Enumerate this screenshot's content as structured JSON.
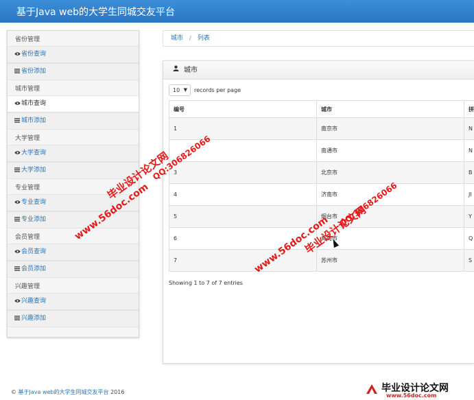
{
  "app": {
    "title": "基于Java web的大学生同城交友平台"
  },
  "sidebar": {
    "groups": [
      {
        "title": "省份管理",
        "items": [
          {
            "label": "省份查询",
            "icon": "eye-icon"
          },
          {
            "label": "省份添加",
            "icon": "list-icon"
          }
        ]
      },
      {
        "title": "城市管理",
        "items": [
          {
            "label": "城市查询",
            "icon": "eye-icon"
          },
          {
            "label": "城市添加",
            "icon": "list-icon"
          }
        ]
      },
      {
        "title": "大学管理",
        "items": [
          {
            "label": "大学查询",
            "icon": "eye-icon"
          },
          {
            "label": "大学添加",
            "icon": "list-icon"
          }
        ]
      },
      {
        "title": "专业管理",
        "items": [
          {
            "label": "专业查询",
            "icon": "eye-icon"
          },
          {
            "label": "专业添加",
            "icon": "list-icon"
          }
        ]
      },
      {
        "title": "会员管理",
        "items": [
          {
            "label": "会员查询",
            "icon": "eye-icon"
          },
          {
            "label": "会员添加",
            "icon": "list-icon"
          }
        ]
      },
      {
        "title": "兴趣管理",
        "items": [
          {
            "label": "兴趣查询",
            "icon": "eye-icon"
          },
          {
            "label": "兴趣添加",
            "icon": "list-icon"
          }
        ]
      }
    ],
    "active_item": "城市查询"
  },
  "breadcrumb": {
    "root": "城市",
    "separator": "/",
    "current": "列表"
  },
  "panel": {
    "title": "城市",
    "length": {
      "value": "10",
      "suffix": "records per page"
    },
    "table": {
      "headers": [
        "编号",
        "城市",
        "拼"
      ],
      "rows": [
        [
          "1",
          "南京市",
          "N"
        ],
        [
          "",
          "南通市",
          "N"
        ],
        [
          "3",
          "北京市",
          "B"
        ],
        [
          "4",
          "济南市",
          "JI"
        ],
        [
          "5",
          "烟台市",
          "Y"
        ],
        [
          "6",
          "青岛市",
          "Q"
        ],
        [
          "7",
          "苏州市",
          "S"
        ]
      ]
    },
    "info": "Showing 1 to 7 of 7 entries"
  },
  "footer": {
    "copyright": "©",
    "site": "基于Java web的大学生同城交友平台",
    "year": "2016"
  },
  "watermarks": {
    "url": "www.56doc.com",
    "cn": "毕业设计论文网",
    "qq": "QQ:306826066"
  },
  "logo": {
    "cn": "毕业设计论文网",
    "url": "www.56doc.com"
  },
  "colors": {
    "topbar": "#2f80cc",
    "link": "#2a72b5",
    "watermark": "#e31a1a"
  }
}
